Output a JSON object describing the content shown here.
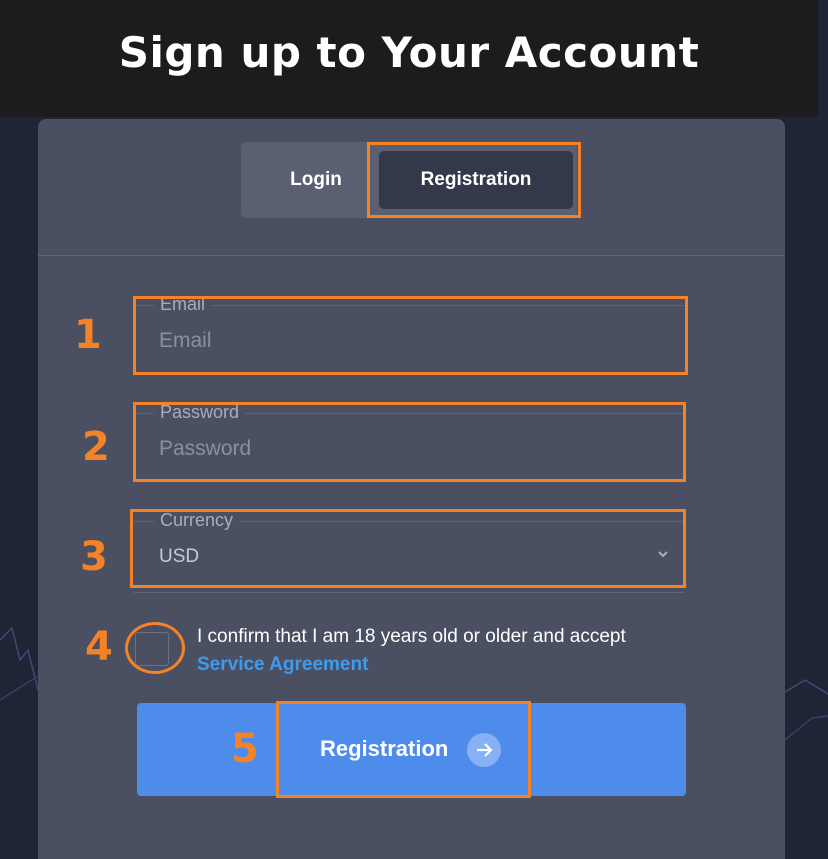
{
  "page": {
    "title": "Sign up to Your Account"
  },
  "tabs": {
    "login": "Login",
    "registration": "Registration"
  },
  "form": {
    "email": {
      "label": "Email",
      "placeholder": "Email"
    },
    "password": {
      "label": "Password",
      "placeholder": "Password"
    },
    "currency": {
      "label": "Currency",
      "value": "USD"
    },
    "agreement": {
      "text": "I confirm that I am 18 years old or older and accept",
      "link": "Service Agreement"
    },
    "submit_label": "Registration"
  },
  "annotations": {
    "step1": "1",
    "step2": "2",
    "step3": "3",
    "step4": "4",
    "step5": "5"
  },
  "colors": {
    "highlight": "#f58227",
    "primary_button": "#4e8cec",
    "link": "#3d9bf0",
    "card": "#4a4f61",
    "header": "#1c1c1e"
  },
  "icons": {
    "currency_chevron": "chevron-down-icon",
    "submit_arrow": "arrow-right-icon"
  }
}
